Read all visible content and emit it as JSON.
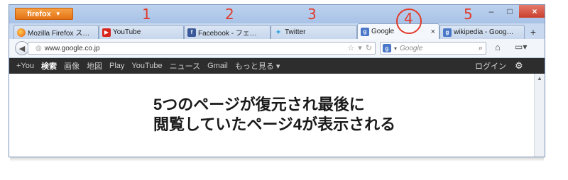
{
  "browser": {
    "app_button": "firefox",
    "window_controls": {
      "minimize": "–",
      "maximize": "□",
      "close": "×"
    },
    "tabs": [
      {
        "label": "Mozilla Firefox ス…",
        "icon": "firefox-icon"
      },
      {
        "label": "YouTube",
        "icon": "youtube-icon"
      },
      {
        "label": "Facebook - フェ…",
        "icon": "facebook-icon"
      },
      {
        "label": "Twitter",
        "icon": "twitter-icon"
      },
      {
        "label": "Google",
        "icon": "google-icon",
        "active": true
      },
      {
        "label": "wikipedia - Goog…",
        "icon": "google-icon"
      }
    ],
    "new_tab": "+",
    "url": "www.google.co.jp",
    "search_placeholder": "Google"
  },
  "google_bar": {
    "items": [
      "+You",
      "検索",
      "画像",
      "地図",
      "Play",
      "YouTube",
      "ニュース",
      "Gmail",
      "もっと見る ▾"
    ],
    "active_item": "検索",
    "login": "ログイン"
  },
  "annotations": {
    "numbers": [
      "1",
      "2",
      "3",
      "4",
      "5"
    ],
    "caption_line1": "5つのページが復元され最後に",
    "caption_line2": "閲覧していたページ4が表示される"
  },
  "colors": {
    "annotation": "#e23a2a",
    "firefox_button": "#e8801f"
  }
}
